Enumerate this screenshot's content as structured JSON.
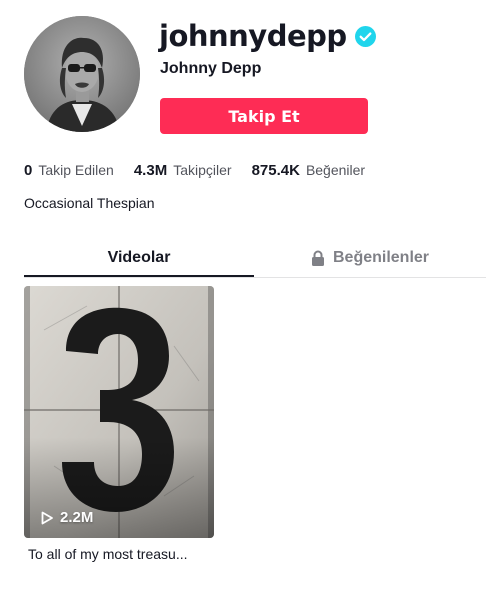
{
  "profile": {
    "username": "johnnydepp",
    "display_name": "Johnny Depp",
    "verified_icon": "verified-check-icon",
    "avatar_icon": "profile-photo",
    "bio": "Occasional Thespian"
  },
  "follow_button": {
    "label": "Takip Et",
    "color": "#fe2c55"
  },
  "stats": {
    "following": {
      "value": "0",
      "label": "Takip Edilen"
    },
    "followers": {
      "value": "4.3M",
      "label": "Takipçiler"
    },
    "likes": {
      "value": "875.4K",
      "label": "Beğeniler"
    }
  },
  "tabs": {
    "videos": "Videolar",
    "liked": "Beğenilenler",
    "liked_icon": "lock-icon",
    "active": "videos"
  },
  "videos": [
    {
      "play_count": "2.2M",
      "caption": "To all of my most treasu...",
      "icon": "play-icon"
    }
  ],
  "colors": {
    "text": "#161823",
    "accent": "#fe2c55",
    "verified": "#20d5ec"
  }
}
